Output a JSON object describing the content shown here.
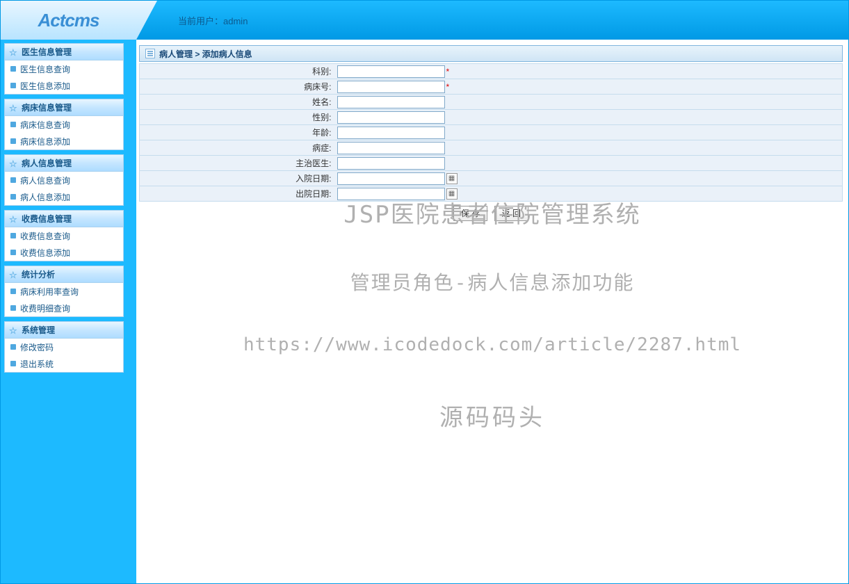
{
  "header": {
    "logo_text": "Actcms",
    "current_user_label": "当前用户：",
    "current_user_value": "admin"
  },
  "sidebar": {
    "groups": [
      {
        "title": "医生信息管理",
        "items": [
          "医生信息查询",
          "医生信息添加"
        ]
      },
      {
        "title": "病床信息管理",
        "items": [
          "病床信息查询",
          "病床信息添加"
        ]
      },
      {
        "title": "病人信息管理",
        "items": [
          "病人信息查询",
          "病人信息添加"
        ]
      },
      {
        "title": "收费信息管理",
        "items": [
          "收费信息查询",
          "收费信息添加"
        ]
      },
      {
        "title": "统计分析",
        "items": [
          "病床利用率查询",
          "收费明细查询"
        ]
      },
      {
        "title": "系统管理",
        "items": [
          "修改密码",
          "退出系统"
        ]
      }
    ]
  },
  "main": {
    "breadcrumb": "病人管理 > 添加病人信息",
    "form_rows": [
      {
        "label": "科别:",
        "required": true,
        "value": "",
        "type": "text"
      },
      {
        "label": "病床号:",
        "required": true,
        "value": "",
        "type": "text"
      },
      {
        "label": "姓名:",
        "required": false,
        "value": "",
        "type": "text"
      },
      {
        "label": "性别:",
        "required": false,
        "value": "",
        "type": "text"
      },
      {
        "label": "年龄:",
        "required": false,
        "value": "",
        "type": "text"
      },
      {
        "label": "病症:",
        "required": false,
        "value": "",
        "type": "text"
      },
      {
        "label": "主治医生:",
        "required": false,
        "value": "",
        "type": "text"
      },
      {
        "label": "入院日期:",
        "required": false,
        "value": "",
        "type": "date"
      },
      {
        "label": "出院日期:",
        "required": false,
        "value": "",
        "type": "date"
      }
    ],
    "buttons": {
      "save": "保 存",
      "back": "返 回"
    }
  },
  "watermark": {
    "line1": "JSP医院患者住院管理系统",
    "line2": "管理员角色-病人信息添加功能",
    "line3": "https://www.icodedock.com/article/2287.html",
    "line4": "源码码头"
  }
}
